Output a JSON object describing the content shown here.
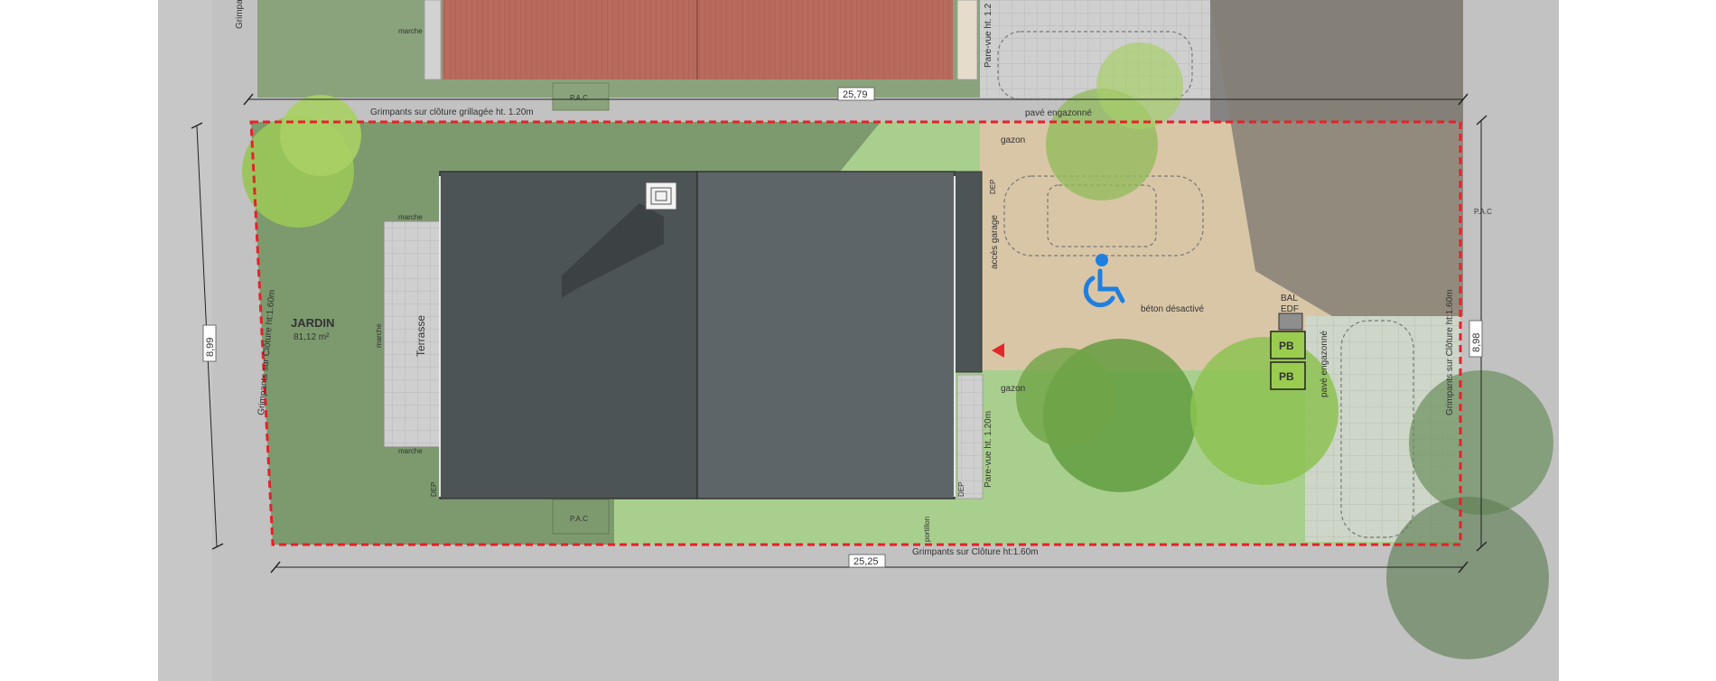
{
  "labels": {
    "jardin": "JARDIN",
    "jardin_area": "81,12 m²",
    "terrasse": "Terrasse",
    "marche": "marche",
    "pac": "P.A.C",
    "dep": "DEP",
    "gazon": "gazon",
    "acces_garage": "accès garage",
    "beton": "béton désactivé",
    "pave_engazonne": "pavé engazonné",
    "pare_vue": "Pare-vue ht. 1.20m",
    "portillon": "portillon",
    "bal": "BAL",
    "edf": "EDF",
    "pb": "PB",
    "grimpants_top": "Grimpants sur clôture grillagée ht. 1.20m",
    "grimpants_bottom": "Grimpants sur Clôture ht:1.60m",
    "grimpants_left": "Grimpants sur Clôture ht:1.60m",
    "grimpants_right": "Grimpants sur Clôture ht:1.60m",
    "grimpant_top_left": "Grimpa",
    "grimpant_top_frag": "Pare-vue ht. 1.2"
  },
  "dimensions": {
    "top": "25,79",
    "bottom": "25,25",
    "left": "8,99",
    "right": "8,98"
  },
  "colors": {
    "boundary": "#e8202a",
    "lawn": "#a9cf8e",
    "shaded_lawn": "#7c9a6e",
    "beton": "#d9c6a6",
    "roof_dark": "#4d5456",
    "roof_light": "#5e6568",
    "neighbor_roof": "#b86a5c",
    "street": "#c2c2c2",
    "accessibility": "#1f7fe0"
  },
  "icons": {
    "accessibility": "wheelchair-icon",
    "access_marker": "red-triangle-marker",
    "chimney": "chimney-icon"
  }
}
